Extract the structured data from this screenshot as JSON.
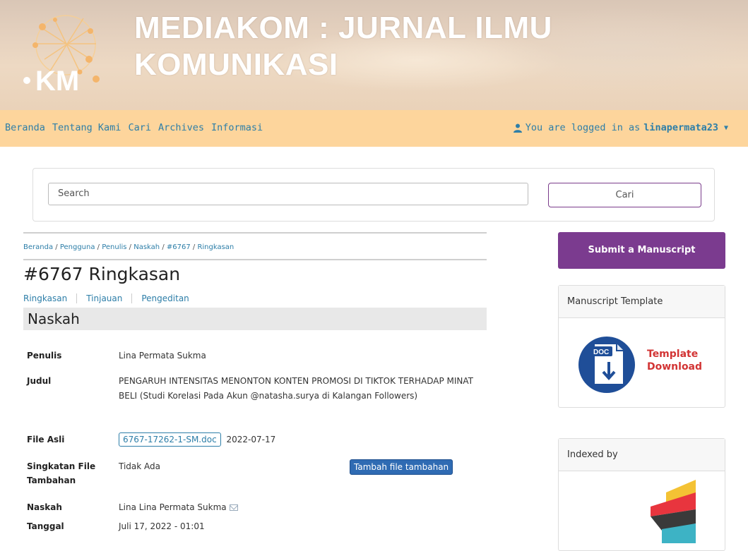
{
  "header": {
    "title_line1": "MEDIAKOM : JURNAL ILMU",
    "title_line2": "KOMUNIKASI",
    "logo_text": "KM"
  },
  "nav": {
    "links": [
      "Beranda",
      "Tentang Kami",
      "Cari",
      "Archives",
      "Informasi"
    ],
    "user_prefix": "You are logged in as",
    "username": "linapermata23"
  },
  "search": {
    "placeholder": "Search",
    "button": "Cari"
  },
  "breadcrumb": [
    "Beranda",
    "Pengguna",
    "Penulis",
    "Naskah",
    "#6767",
    "Ringkasan"
  ],
  "page_title": "#6767 Ringkasan",
  "tabs": [
    "Ringkasan",
    "Tinjauan",
    "Pengeditan"
  ],
  "section": "Naskah",
  "details": {
    "penulis_label": "Penulis",
    "penulis": "Lina Permata Sukma",
    "judul_label": "Judul",
    "judul": "PENGARUH INTENSITAS MENONTON KONTEN PROMOSI DI TIKTOK TERHADAP MINAT BELI (Studi Korelasi Pada Akun @natasha.surya di Kalangan Followers)",
    "file_asli_label": "File Asli",
    "file_asli": "6767-17262-1-SM.doc",
    "file_asli_date": "2022-07-17",
    "singkatan_label": "Singkatan File Tambahan",
    "singkatan": "Tidak Ada",
    "add_file_button": "Tambah file tambahan",
    "naskah_label": "Naskah",
    "naskah": "Lina Lina Permata Sukma",
    "tanggal_label": "Tanggal",
    "tanggal": "Juli 17, 2022 - 01:01"
  },
  "sidebar": {
    "submit_button": "Submit a Manuscript",
    "template_heading": "Manuscript Template",
    "template_line1": "Template",
    "template_line2": "Download",
    "doc_badge": "DOC",
    "indexed_heading": "Indexed by"
  },
  "colors": {
    "navbar": "#fdd59c",
    "link": "#2d7ea8",
    "submit": "#7b3b8f",
    "add_button": "#2f6bb3"
  }
}
